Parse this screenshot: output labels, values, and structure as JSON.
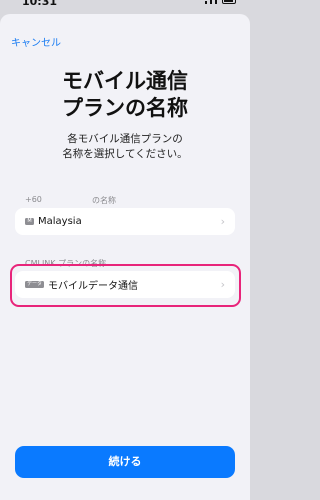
{
  "status": {
    "time": "10:31"
  },
  "sheet": {
    "cancel_label": "キャンセル",
    "title_line1": "モバイル通信",
    "title_line2": "プランの名称",
    "subtitle_line1": "各モバイル通信プランの",
    "subtitle_line2": "名称を選択してください。"
  },
  "plan1": {
    "number": "+60",
    "section_label": "の名称",
    "tag": "M",
    "value": "Malaysia"
  },
  "plan2": {
    "section_label": "CMLINK プランの名称",
    "tag": "データ",
    "value": "モバイルデータ通信"
  },
  "continue_label": "続ける",
  "colors": {
    "accent": "#0a7aff",
    "highlight": "#e8247a"
  }
}
